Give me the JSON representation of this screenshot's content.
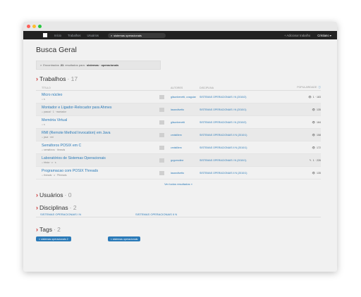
{
  "nav": {
    "links": [
      "Início",
      "Trabalhos",
      "Usuários"
    ],
    "search_value": "sistemas operacionais",
    "add_label": "+ Adicionar trabalho",
    "user_label": "Cristiano"
  },
  "page": {
    "title": "Busca Geral",
    "result_prefix": "Encontrados",
    "result_count": "21",
    "result_mid": "resultados para:",
    "result_query": "sistemas · operacionais"
  },
  "trabalhos": {
    "label": "Trabalhos",
    "count": "· 17",
    "headers": [
      "TÍTULO",
      "AUTORES",
      "DISCIPLINA",
      "POPULARIDADE"
    ],
    "rows": [
      {
        "title": "Micro núcleo",
        "tags": "s",
        "authors": "gilsonbenetti, cvaguiar",
        "discipline": "SISTEMAS OPERACIONAIS I N (2010/2)",
        "pop": "1 · 183"
      },
      {
        "title": "Montador e Ligador-Relocador para Ahmes",
        "tags": "pascal · 1 · montador",
        "authors": "lasarolivetto",
        "discipline": "SISTEMAS OPERACIONAIS I N (2010/1)",
        "pop": "135"
      },
      {
        "title": "Memória Virtual",
        "tags": "s",
        "authors": "gilsonbenetti",
        "discipline": "SISTEMAS OPERACIONAIS I N (2010/2)",
        "pop": "184"
      },
      {
        "title": "RMI (Remote Method Invocation) em Java",
        "tags": "java · rmi",
        "authors": "cmistillem",
        "discipline": "SISTEMAS OPERACIONAIS II N (2010/1)",
        "pop": "158"
      },
      {
        "title": "Semáforos POSIX em C",
        "tags": "semáforos · threads",
        "authors": "cmistillem",
        "discipline": "SISTEMAS OPERACIONAIS II N (2010/1)",
        "pop": "172"
      },
      {
        "title": "Laboratórios de Sistemas Operacionais",
        "tags": "bbcia · c · s",
        "authors": "gcgomoline",
        "discipline": "SISTEMAS OPERACIONAIS I N (2010/1)",
        "pop": "1 · 226"
      },
      {
        "title": "Programacao com POSIX Threads",
        "tags": "threads · c · Pthreads",
        "authors": "lasarolivetto",
        "discipline": "SISTEMAS OPERACIONAIS II N (2010/1)",
        "pop": "135"
      }
    ],
    "more_label": "Ver todos resultados »"
  },
  "usuarios": {
    "label": "Usuários",
    "count": "· 0"
  },
  "disciplinas": {
    "label": "Disciplinas",
    "count": "· 2",
    "items": [
      "SISTEMAS OPERACIONAIS I N",
      "SISTEMAS OPERACIONAIS II N"
    ]
  },
  "tags": {
    "label": "Tags",
    "count": "· 2",
    "items": [
      "sistemas operacionais 2",
      "sistemas operacionais"
    ]
  },
  "colors": {
    "accent": "#2a7ab8",
    "section_arrow": "#cc3333",
    "navbar": "#222222"
  }
}
